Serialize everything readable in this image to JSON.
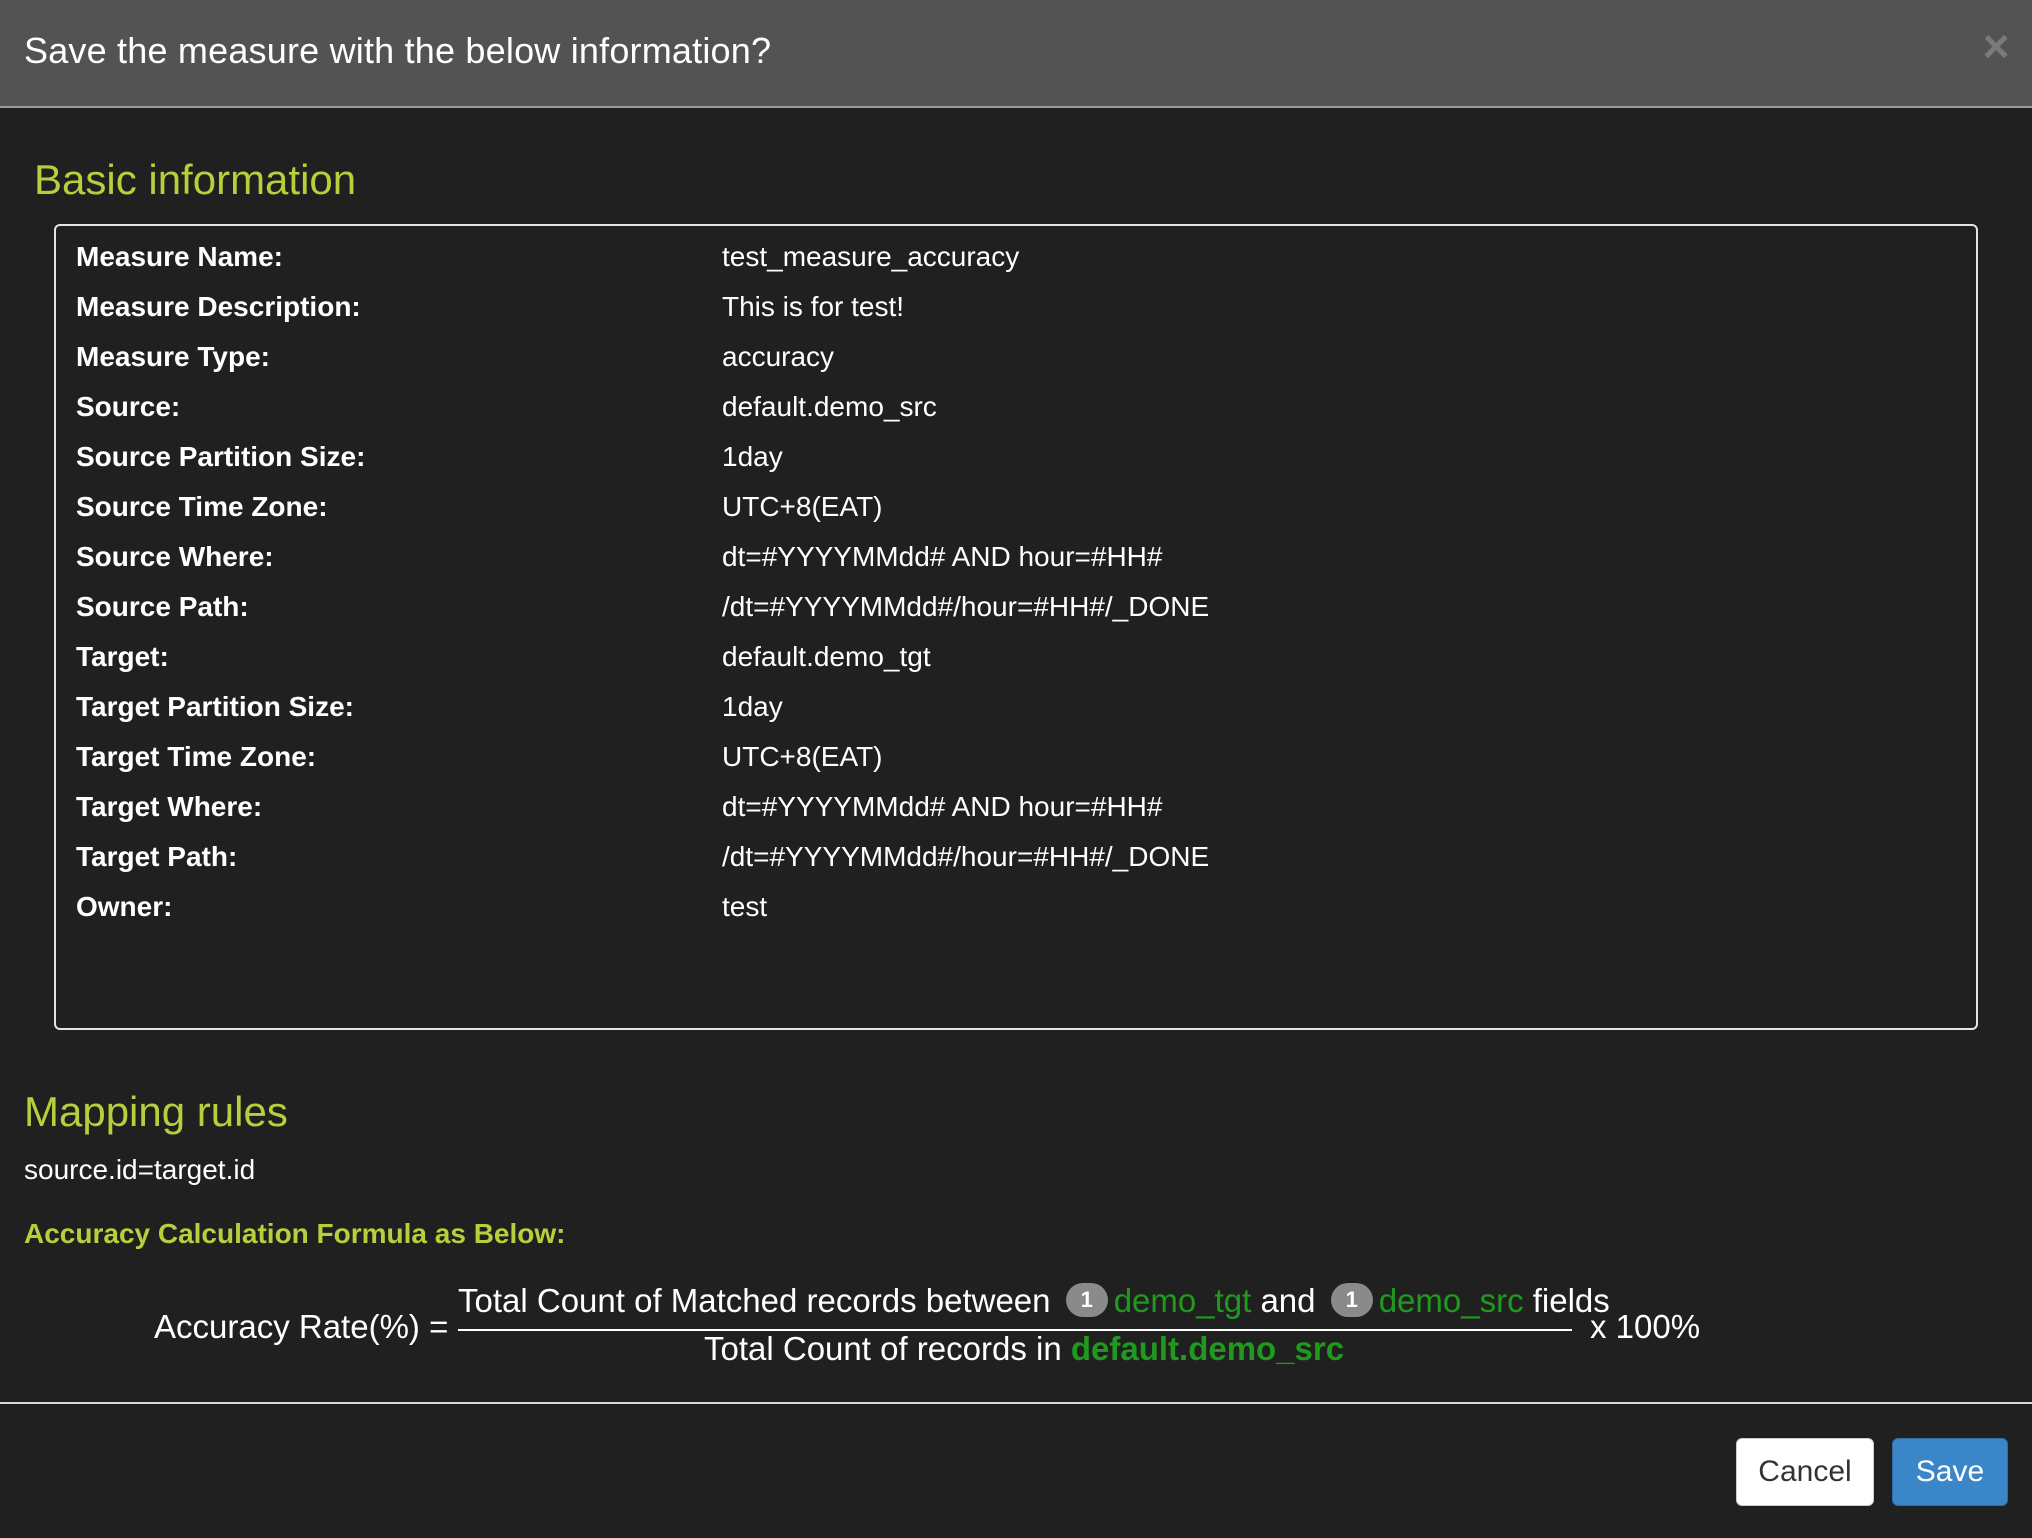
{
  "header": {
    "title": "Save the measure with the below information?",
    "close_label": "×"
  },
  "basic": {
    "title": "Basic information",
    "rows": [
      {
        "label": "Measure Name:",
        "value": "test_measure_accuracy"
      },
      {
        "label": "Measure Description:",
        "value": "This is for test!"
      },
      {
        "label": "Measure Type:",
        "value": "accuracy"
      },
      {
        "label": "Source:",
        "value": "default.demo_src"
      },
      {
        "label": "Source Partition Size:",
        "value": "1day"
      },
      {
        "label": "Source Time Zone:",
        "value": "UTC+8(EAT)"
      },
      {
        "label": "Source Where:",
        "value": "dt=#YYYYMMdd# AND hour=#HH#"
      },
      {
        "label": "Source Path:",
        "value": "/dt=#YYYYMMdd#/hour=#HH#/_DONE"
      },
      {
        "label": "Target:",
        "value": "default.demo_tgt"
      },
      {
        "label": "Target Partition Size:",
        "value": "1day"
      },
      {
        "label": "Target Time Zone:",
        "value": "UTC+8(EAT)"
      },
      {
        "label": "Target Where:",
        "value": "dt=#YYYYMMdd# AND hour=#HH#"
      },
      {
        "label": "Target Path:",
        "value": "/dt=#YYYYMMdd#/hour=#HH#/_DONE"
      },
      {
        "label": "Owner:",
        "value": "test"
      }
    ]
  },
  "mapping": {
    "title": "Mapping rules",
    "rule": "source.id=target.id",
    "formula_title": "Accuracy Calculation Formula as Below:"
  },
  "formula": {
    "lhs": "Accuracy Rate(%) =",
    "num_text1": "Total Count of Matched records between",
    "tgt_count": "1",
    "tgt_name": "demo_tgt",
    "num_and": "and",
    "src_count": "1",
    "src_name": "demo_src",
    "num_fields": "fields",
    "den_text": "Total Count of records in",
    "den_source": "default.demo_src",
    "multiplier": "x 100%"
  },
  "footer": {
    "cancel_label": "Cancel",
    "save_label": "Save"
  },
  "colors": {
    "header_bg": "#535353",
    "body_bg": "#202020",
    "section_title": "#b8cf3c",
    "highlight_green": "#1f9a1f",
    "save_button": "#3a86c8"
  }
}
